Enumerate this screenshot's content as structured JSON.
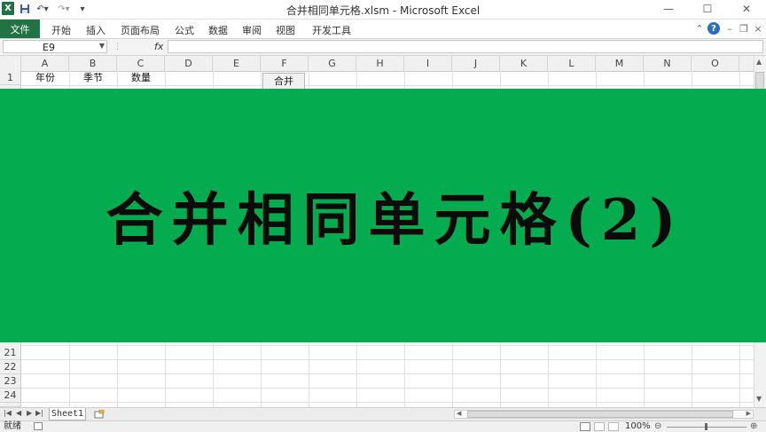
{
  "window": {
    "title": "合并相同单元格.xlsm - Microsoft Excel",
    "app_icon": "excel-logo-icon",
    "controls": [
      "minimize-icon",
      "maximize-icon",
      "close-icon"
    ]
  },
  "qat": {
    "icons": [
      "save-icon",
      "undo-icon",
      "redo-icon",
      "customize-qat-icon"
    ]
  },
  "ribbon": {
    "file_tab": "文件",
    "tabs": [
      "开始",
      "插入",
      "页面布局",
      "公式",
      "数据",
      "审阅",
      "视图",
      "开发工具"
    ],
    "right_icons": [
      "minimize-ribbon-icon",
      "help-icon",
      "window-minimize-icon",
      "window-restore-icon",
      "window-close-icon"
    ]
  },
  "formula_bar": {
    "name_box": "E9",
    "fx_label": "fx",
    "formula": ""
  },
  "grid": {
    "columns": [
      "A",
      "B",
      "C",
      "D",
      "E",
      "F",
      "G",
      "H",
      "I",
      "J",
      "K",
      "L",
      "M",
      "N",
      "O"
    ],
    "top_rows": [
      "1"
    ],
    "bottom_rows": [
      "21",
      "22",
      "23",
      "24"
    ],
    "row1": {
      "A": "年份",
      "B": "季节",
      "C": "数量"
    },
    "button_label": "合并"
  },
  "sheets": {
    "tabs": [
      "Sheet1"
    ]
  },
  "status": {
    "ready": "就绪",
    "zoom": "100%"
  },
  "overlay": {
    "text": "合并相同单元格(2)"
  },
  "colors": {
    "accent": "#217346",
    "banner": "#05ac4f"
  }
}
